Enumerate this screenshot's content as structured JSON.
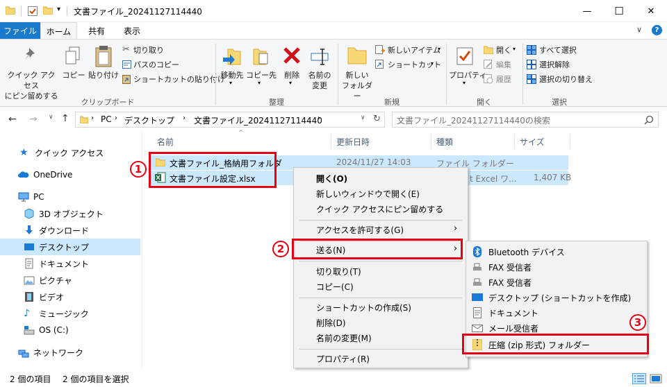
{
  "window": {
    "title": "文書ファイル_20241127114440",
    "minimize": "—",
    "maximize": "☐",
    "close": "✕"
  },
  "tabs": {
    "file": "ファイル",
    "home": "ホーム",
    "share": "共有",
    "view": "表示"
  },
  "ribbon": {
    "clipboard": {
      "pin": "クイック アクセス\nにピン留めする",
      "copy": "コピー",
      "paste": "貼り付け",
      "cut": "切り取り",
      "copy_path": "パスのコピー",
      "paste_shortcut": "ショートカットの貼り付け",
      "group": "クリップボード"
    },
    "organize": {
      "move_to": "移動先",
      "copy_to": "コピー先",
      "delete": "削除",
      "rename": "名前の\n変更",
      "group": "整理"
    },
    "new": {
      "new_folder": "新しい\nフォルダー",
      "new_item": "新しいアイテム",
      "shortcut": "ショートカット",
      "group": "新規"
    },
    "open": {
      "properties": "プロパティ",
      "open": "開く",
      "edit": "編集",
      "history": "履歴",
      "group": "開く"
    },
    "select": {
      "select_all": "すべて選択",
      "select_none": "選択解除",
      "invert": "選択の切り替え",
      "group": "選択"
    }
  },
  "address": {
    "pc": "PC",
    "desktop": "デスクトップ",
    "folder": "文書ファイル_20241127114440",
    "search_placeholder": "文書ファイル_20241127114440の検索"
  },
  "nav": {
    "quick_access": "クイック アクセス",
    "onedrive": "OneDrive",
    "pc": "PC",
    "objects3d": "3D オブジェクト",
    "downloads": "ダウンロード",
    "desktop": "デスクトップ",
    "documents": "ドキュメント",
    "pictures": "ピクチャ",
    "videos": "ビデオ",
    "music": "ミュージック",
    "os": "OS (C:)",
    "network": "ネットワーク"
  },
  "columns": {
    "name": "名前",
    "date": "更新日時",
    "type": "種類",
    "size": "サイズ"
  },
  "files": [
    {
      "name": "文書ファイル_格納用フォルダ",
      "date": "2024/11/27 14:03",
      "type": "ファイル フォルダー",
      "size": ""
    },
    {
      "name": "文書ファイル設定.xlsx",
      "date": "",
      "type": "t Excel ワ...",
      "size": "1,407 KB"
    }
  ],
  "context_menu": {
    "open": "開く(O)",
    "open_new_window": "新しいウィンドウで開く(E)",
    "pin_quick": "クイック アクセスにピン留めする",
    "grant_access": "アクセスを許可する(G)",
    "send_to": "送る(N)",
    "cut": "切り取り(T)",
    "copy": "コピー(C)",
    "create_shortcut": "ショートカットの作成(S)",
    "delete": "削除(D)",
    "rename": "名前の変更(M)",
    "properties": "プロパティ(R)"
  },
  "send_to_menu": {
    "bluetooth": "Bluetooth デバイス",
    "fax1": "FAX 受信者",
    "fax2": "FAX 受信者",
    "desktop_shortcut": "デスクトップ (ショートカットを作成)",
    "documents": "ドキュメント",
    "mail": "メール受信者",
    "zip": "圧縮 (zip 形式) フォルダー"
  },
  "annotations": {
    "one": "1",
    "two": "2",
    "three": "3"
  },
  "status": {
    "count": "2 個の項目",
    "selected": "2 個の項目を選択"
  },
  "colors": {
    "accent": "#1979ca",
    "selection": "#cce8ff",
    "highlight_red": "#e60012"
  }
}
